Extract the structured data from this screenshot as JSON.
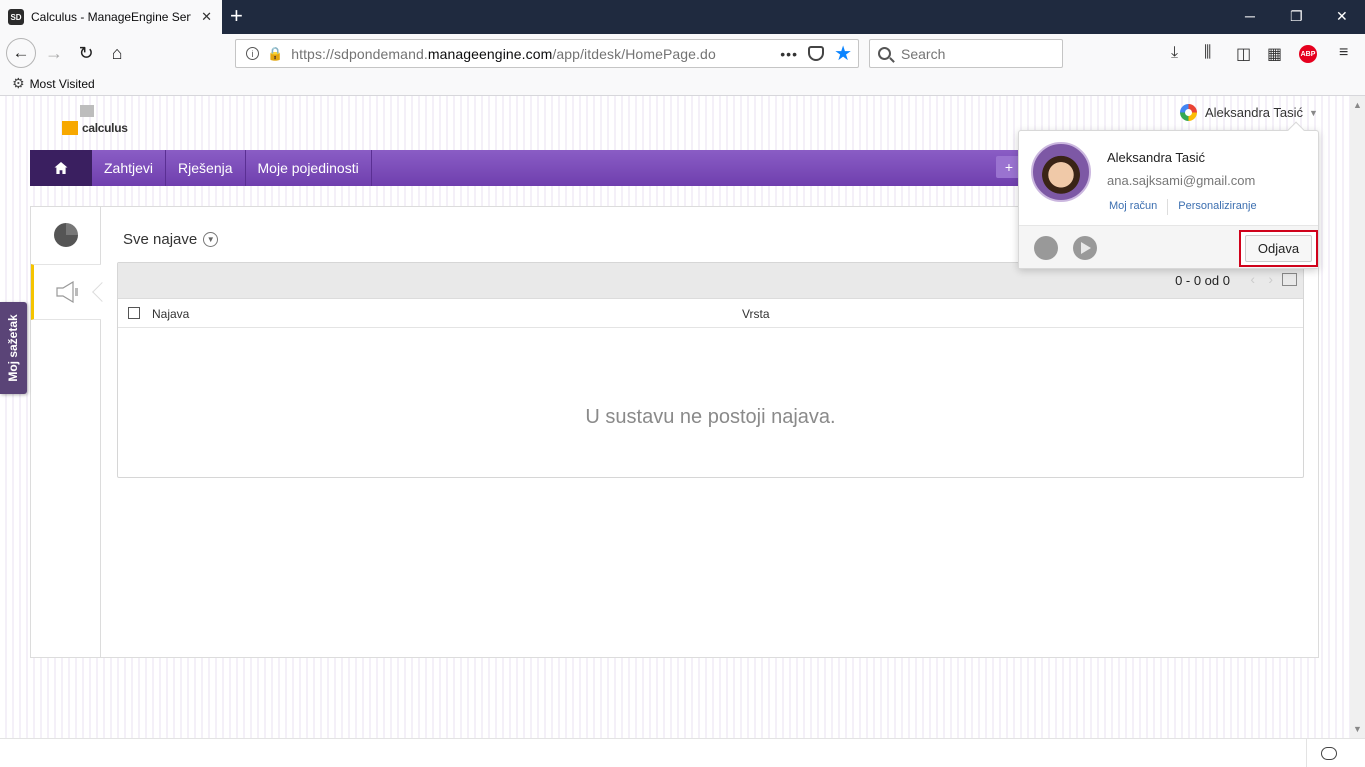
{
  "browser": {
    "tab_title": "Calculus - ManageEngine ServiceDesk",
    "favicon_text": "SD",
    "url_plain_prefix": "https://sdpondemand.",
    "url_domain": "manageengine.com",
    "url_path": "/app/itdesk/HomePage.do",
    "search_placeholder": "Search",
    "bookmark": "Most Visited",
    "abp_label": "ABP"
  },
  "header": {
    "logo_text": "calculus",
    "user_name": "Aleksandra Tasić"
  },
  "menu": {
    "items": [
      "Zahtjevi",
      "Rješenja",
      "Moje pojedinosti"
    ],
    "plus_label": "+"
  },
  "side_tab": "Moj sažetak",
  "announcements": {
    "view_title": "Sve najave",
    "pager": "0 - 0 od 0",
    "columns": [
      "Najava",
      "Vrsta"
    ],
    "empty_message": "U sustavu ne postoji najava."
  },
  "popup": {
    "name": "Aleksandra Tasić",
    "email": "ana.sajksami@gmail.com",
    "links": [
      "Moj račun",
      "Personaliziranje"
    ],
    "logout": "Odjava"
  }
}
